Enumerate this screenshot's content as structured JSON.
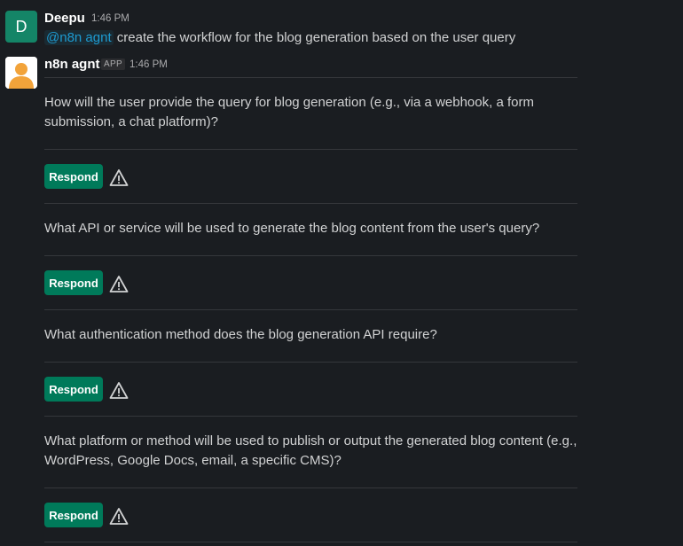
{
  "user_message": {
    "avatar_letter": "D",
    "sender": "Deepu",
    "time": "1:46 PM",
    "mention": "@n8n agnt",
    "text": "create the workflow for the blog generation based on the user query"
  },
  "bot_message": {
    "sender": "n8n agnt",
    "badge": "APP",
    "time": "1:46 PM",
    "respond_label": "Respond",
    "questions": [
      "How will the user provide the query for blog generation (e.g., via a webhook, a form submission, a chat platform)?",
      "What API or service will be used to generate the blog content from the user's query?",
      "What authentication method does the blog generation API require?",
      "What platform or method will be used to publish or output the generated blog content (e.g., WordPress, Google Docs, email, a specific CMS)?"
    ],
    "icons": {
      "avatar": "user-avatar-icon",
      "warning": "warning-triangle-icon"
    }
  },
  "colors": {
    "background": "#1a1d21",
    "button": "#007a5a",
    "mention": "#1d9bd1",
    "avatar_d": "#148567"
  }
}
